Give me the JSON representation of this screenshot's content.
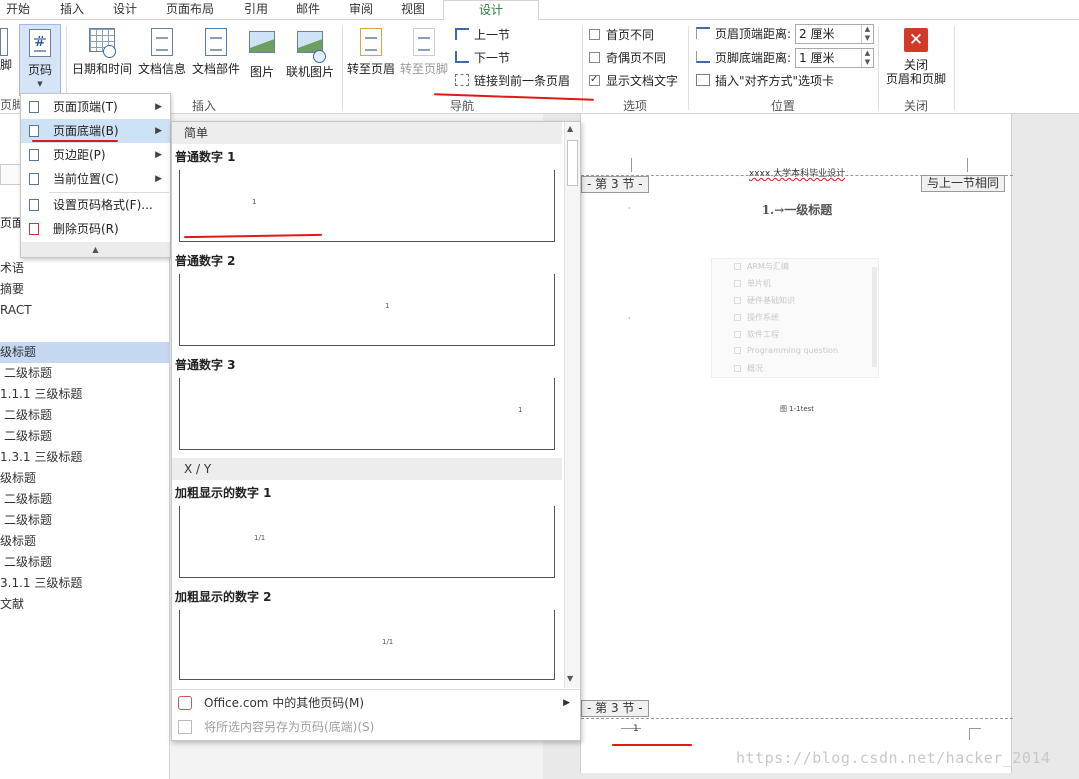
{
  "tabs": [
    "开始",
    "插入",
    "设计",
    "页面布局",
    "引用",
    "邮件",
    "审阅",
    "视图",
    "设计"
  ],
  "ribbon": {
    "left_cut_label_1": "脚",
    "left_cut_label_2": "页脚",
    "page_number_button": "页码",
    "date_time_button": "日期和时间",
    "doc_info_button": "文档信息",
    "doc_parts_button": "文档部件",
    "picture_button": "图片",
    "online_picture_button": "联机图片",
    "goto_header_button": "转至页眉",
    "goto_footer_button": "转至页脚",
    "prev_section": "上一节",
    "next_section": "下一节",
    "link_prev": "链接到前一条页眉",
    "nav_group_label": "导航",
    "insert_group_label": "插入",
    "opt_diff_first": "首页不同",
    "opt_diff_odd_even": "奇偶页不同",
    "opt_show_doc_text": "显示文档文字",
    "options_group_label": "选项",
    "header_top_distance_label": "页眉顶端距离:",
    "header_top_distance_value": "2 厘米",
    "footer_bottom_distance_label": "页脚底端距离:",
    "footer_bottom_distance_value": "1 厘米",
    "insert_align_tab": "插入\"对齐方式\"选项卡",
    "position_group_label": "位置",
    "close_button_line1": "关闭",
    "close_button_line2": "页眉和页脚",
    "close_group_label": "关闭"
  },
  "page_number_menu": [
    {
      "label": "页面顶端(T)",
      "has_submenu": true
    },
    {
      "label": "页面底端(B)",
      "has_submenu": true,
      "highlighted": true
    },
    {
      "label": "页边距(P)",
      "has_submenu": true
    },
    {
      "label": "当前位置(C)",
      "has_submenu": true
    },
    {
      "label": "设置页码格式(F)...",
      "has_submenu": false
    },
    {
      "label": "删除页码(R)",
      "has_submenu": false
    }
  ],
  "nav_pane": {
    "cut_items": [
      "页面",
      "术语",
      "摘要",
      "RACT",
      "级标题",
      "二级标题",
      "1.1.1 三级标题",
      "二级标题",
      "二级标题",
      "1.3.1 三级标题",
      "级标题",
      "二级标题",
      "二级标题",
      "级标题",
      "二级标题",
      "3.1.1 三级标题",
      "文献"
    ]
  },
  "gallery": {
    "section_simple": "简单",
    "items_simple": [
      {
        "title": "普通数字 1",
        "sample": "1"
      },
      {
        "title": "普通数字 2",
        "sample": "1"
      },
      {
        "title": "普通数字 3",
        "sample": "1"
      }
    ],
    "section_xy": "X / Y",
    "items_xy": [
      {
        "title": "加粗显示的数字 1",
        "sample": "1/1"
      },
      {
        "title": "加粗显示的数字 2",
        "sample": "1/1"
      }
    ],
    "more_online": "Office.com 中的其他页码(M)",
    "save_selection": "将所选内容另存为页码(底端)(S)"
  },
  "document": {
    "header_text": "xxxx 大学本科毕业设计",
    "section_label_top": "- 第 3 节 -",
    "same_as_prev": "与上一节相同",
    "heading": "1.→一级标题",
    "figure_items": [
      "ARM与汇编",
      "单片机",
      "硬件基础知识",
      "操作系统",
      "软件工程",
      "Programming question",
      "概况"
    ],
    "figure_caption": "图 1-1test",
    "section_label_bottom": "- 第 3 节 -",
    "footer_number": "1"
  },
  "watermark": "https://blog.csdn.net/hacker_2014"
}
